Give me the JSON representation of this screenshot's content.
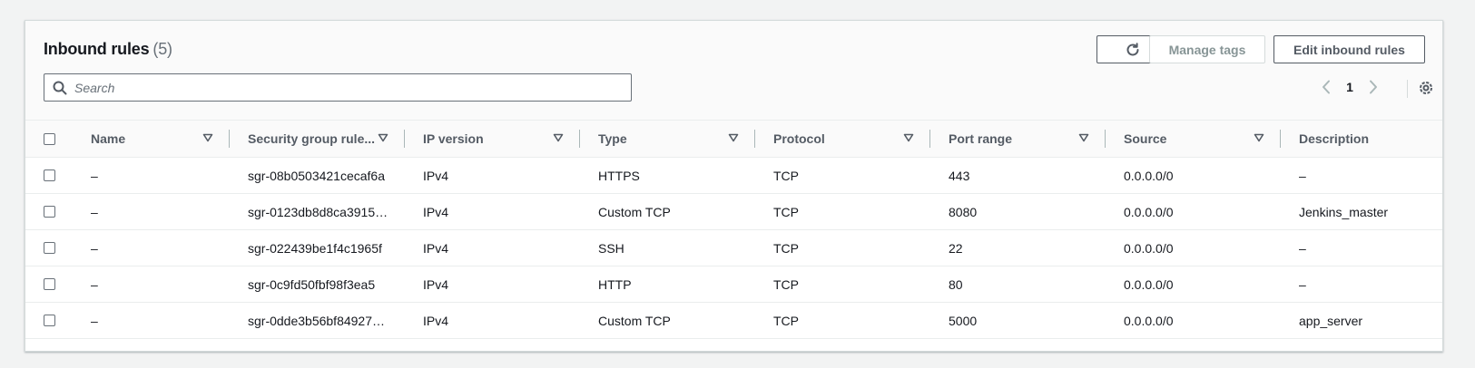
{
  "header": {
    "title": "Inbound rules",
    "count": "(5)",
    "manage_tags_label": "Manage tags",
    "edit_label": "Edit inbound rules"
  },
  "search": {
    "placeholder": "Search"
  },
  "pagination": {
    "current_page": "1"
  },
  "columns": [
    "Name",
    "Security group rule...",
    "IP version",
    "Type",
    "Protocol",
    "Port range",
    "Source",
    "Description"
  ],
  "rows": [
    {
      "name": "–",
      "rule_id": "sgr-08b0503421cecaf6a",
      "ip_version": "IPv4",
      "type": "HTTPS",
      "protocol": "TCP",
      "port_range": "443",
      "source": "0.0.0.0/0",
      "description": "–"
    },
    {
      "name": "–",
      "rule_id": "sgr-0123db8d8ca3915…",
      "ip_version": "IPv4",
      "type": "Custom TCP",
      "protocol": "TCP",
      "port_range": "8080",
      "source": "0.0.0.0/0",
      "description": "Jenkins_master"
    },
    {
      "name": "–",
      "rule_id": "sgr-022439be1f4c1965f",
      "ip_version": "IPv4",
      "type": "SSH",
      "protocol": "TCP",
      "port_range": "22",
      "source": "0.0.0.0/0",
      "description": "–"
    },
    {
      "name": "–",
      "rule_id": "sgr-0c9fd50fbf98f3ea5",
      "ip_version": "IPv4",
      "type": "HTTP",
      "protocol": "TCP",
      "port_range": "80",
      "source": "0.0.0.0/0",
      "description": "–"
    },
    {
      "name": "–",
      "rule_id": "sgr-0dde3b56bf84927…",
      "ip_version": "IPv4",
      "type": "Custom TCP",
      "protocol": "TCP",
      "port_range": "5000",
      "source": "0.0.0.0/0",
      "description": "app_server"
    }
  ],
  "icons": {
    "refresh": "refresh-icon",
    "search": "search-icon",
    "prev": "chevron-left-icon",
    "next": "chevron-right-icon",
    "settings": "gear-icon",
    "sort": "sort-caret-icon"
  }
}
